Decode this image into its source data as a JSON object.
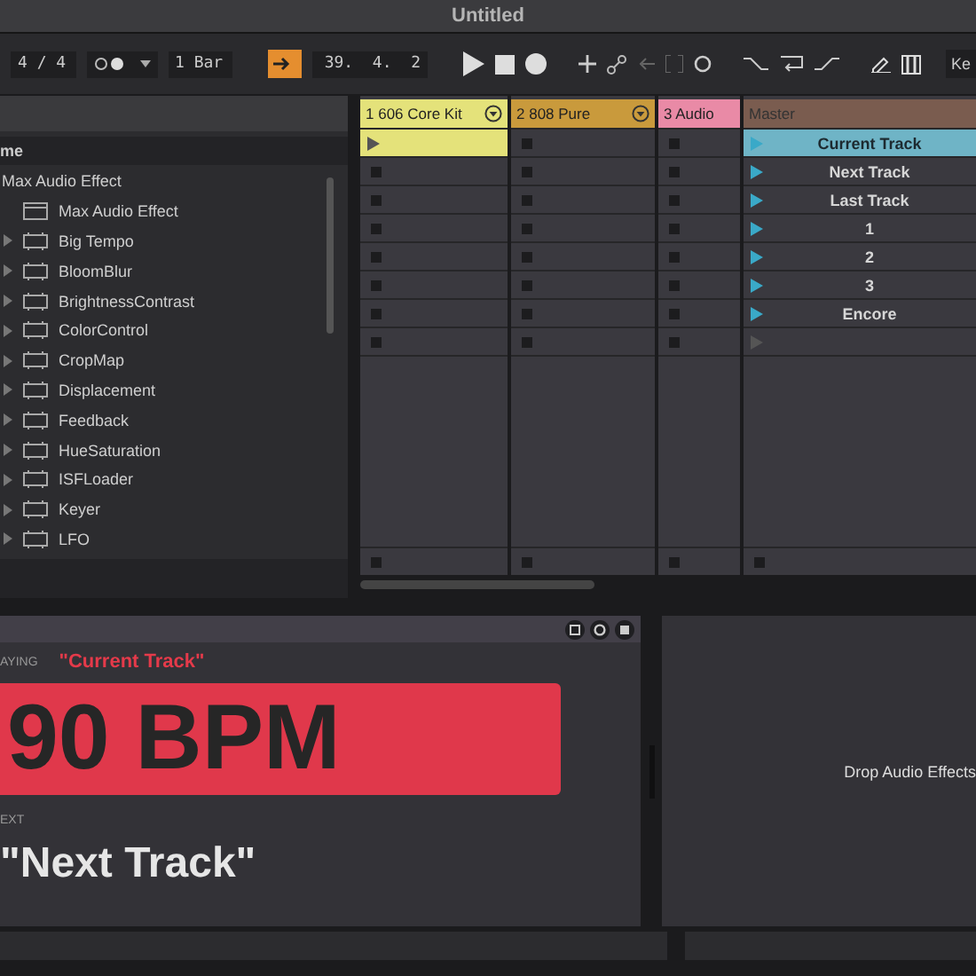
{
  "window": {
    "title": "Untitled"
  },
  "toolbar": {
    "time_signature": "4 / 4",
    "quantize": "1 Bar",
    "position": "39.  4.  2",
    "key_label": "Ke"
  },
  "browser": {
    "column_header": "me",
    "folder": "Max Audio Effect",
    "items": [
      {
        "label": "Max Audio Effect",
        "kind": "device"
      },
      {
        "label": "Big Tempo",
        "kind": "preset"
      },
      {
        "label": "BloomBlur",
        "kind": "preset"
      },
      {
        "label": "BrightnessContrast",
        "kind": "preset"
      },
      {
        "label": "ColorControl",
        "kind": "preset"
      },
      {
        "label": "CropMap",
        "kind": "preset"
      },
      {
        "label": "Displacement",
        "kind": "preset"
      },
      {
        "label": "Feedback",
        "kind": "preset"
      },
      {
        "label": "HueSaturation",
        "kind": "preset"
      },
      {
        "label": "ISFLoader",
        "kind": "preset"
      },
      {
        "label": "Keyer",
        "kind": "preset"
      },
      {
        "label": "LFO",
        "kind": "preset"
      }
    ]
  },
  "tracks": [
    {
      "name": "1 606 Core Kit",
      "color": "#e4e27a",
      "menu": true,
      "slots": [
        {
          "kind": "clip"
        },
        {
          "kind": "empty"
        },
        {
          "kind": "empty"
        },
        {
          "kind": "empty"
        },
        {
          "kind": "empty"
        },
        {
          "kind": "empty"
        },
        {
          "kind": "empty"
        },
        {
          "kind": "empty"
        }
      ]
    },
    {
      "name": "2 808 Pure",
      "color": "#c99a3c",
      "menu": true,
      "slots": [
        {
          "kind": "empty"
        },
        {
          "kind": "empty"
        },
        {
          "kind": "empty"
        },
        {
          "kind": "empty"
        },
        {
          "kind": "empty"
        },
        {
          "kind": "empty"
        },
        {
          "kind": "empty"
        },
        {
          "kind": "empty"
        }
      ]
    },
    {
      "name": "3 Audio",
      "color": "#e98aa6",
      "menu": false,
      "slots": [
        {
          "kind": "empty"
        },
        {
          "kind": "empty"
        },
        {
          "kind": "empty"
        },
        {
          "kind": "empty"
        },
        {
          "kind": "empty"
        },
        {
          "kind": "empty"
        },
        {
          "kind": "empty"
        },
        {
          "kind": "empty"
        }
      ]
    }
  ],
  "master": {
    "name": "Master",
    "scenes": [
      {
        "label": "Current Track",
        "selected": true
      },
      {
        "label": "Next Track",
        "selected": false
      },
      {
        "label": "Last Track",
        "selected": false
      },
      {
        "label": "1",
        "selected": false
      },
      {
        "label": "2",
        "selected": false
      },
      {
        "label": "3",
        "selected": false
      },
      {
        "label": "Encore",
        "selected": false
      }
    ]
  },
  "device": {
    "playing_label": "AYING",
    "current": "\"Current Track\"",
    "tempo": "90 BPM",
    "next_label": "EXT",
    "next": "\"Next Track\""
  },
  "drop_zone": {
    "text": "Drop Audio Effects"
  }
}
